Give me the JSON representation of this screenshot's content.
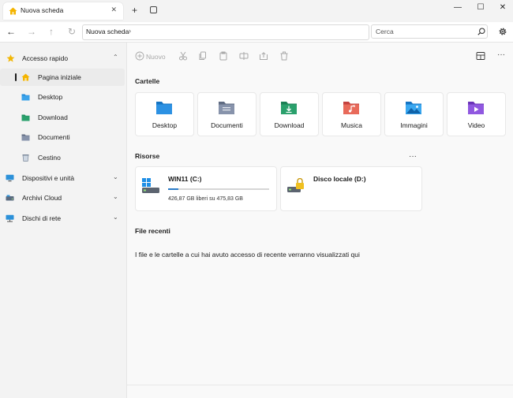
{
  "tab": {
    "title": "Nuova scheda",
    "close_glyph": "✕"
  },
  "titlebar": {
    "new_tab_glyph": "+",
    "minimize_glyph": "—",
    "maximize_glyph": "☐",
    "close_glyph": "✕"
  },
  "address": {
    "back_glyph": "←",
    "forward_glyph": "→",
    "up_glyph": "↑",
    "refresh_glyph": "↻",
    "breadcrumb": "Nuova scheda",
    "breadcrumb_chevron": "›",
    "search_placeholder": "Cerca"
  },
  "sidebar": {
    "items": [
      {
        "label": "Accesso rapido",
        "chevron": "⌃"
      },
      {
        "label": "Pagina iniziale"
      },
      {
        "label": "Desktop"
      },
      {
        "label": "Download"
      },
      {
        "label": "Documenti"
      },
      {
        "label": "Cestino"
      },
      {
        "label": "Dispositivi e unità",
        "chevron": "⌄"
      },
      {
        "label": "Archivi Cloud",
        "chevron": "⌄"
      },
      {
        "label": "Dischi di rete",
        "chevron": "⌄"
      }
    ]
  },
  "toolbar": {
    "new_label": "Nuovo",
    "more_glyph": "···"
  },
  "sections": {
    "folders": "Cartelle",
    "resources": "Risorse",
    "recent": "File recenti",
    "resources_more": "···"
  },
  "folders": [
    {
      "label": "Desktop",
      "color": "#1e88d8"
    },
    {
      "label": "Documenti",
      "color": "#7d8aa3"
    },
    {
      "label": "Download",
      "color": "#2aa06c"
    },
    {
      "label": "Musica",
      "color": "#e0625a"
    },
    {
      "label": "Immagini",
      "color": "#2c91d9"
    },
    {
      "label": "Video",
      "color": "#8a4fd8"
    }
  ],
  "drives": [
    {
      "name": "WIN11 (C:)",
      "space": "426,87 GB liberi su 475,83 GB",
      "used_fraction": 0.103
    },
    {
      "name": "Disco locale (D:)"
    }
  ],
  "recent_empty_message": "I file e le cartelle a cui hai avuto accesso di recente verranno visualizzati qui",
  "colors": {
    "accent": "#2a7bc7",
    "star": "#f2b705",
    "home": "#f4b400"
  }
}
